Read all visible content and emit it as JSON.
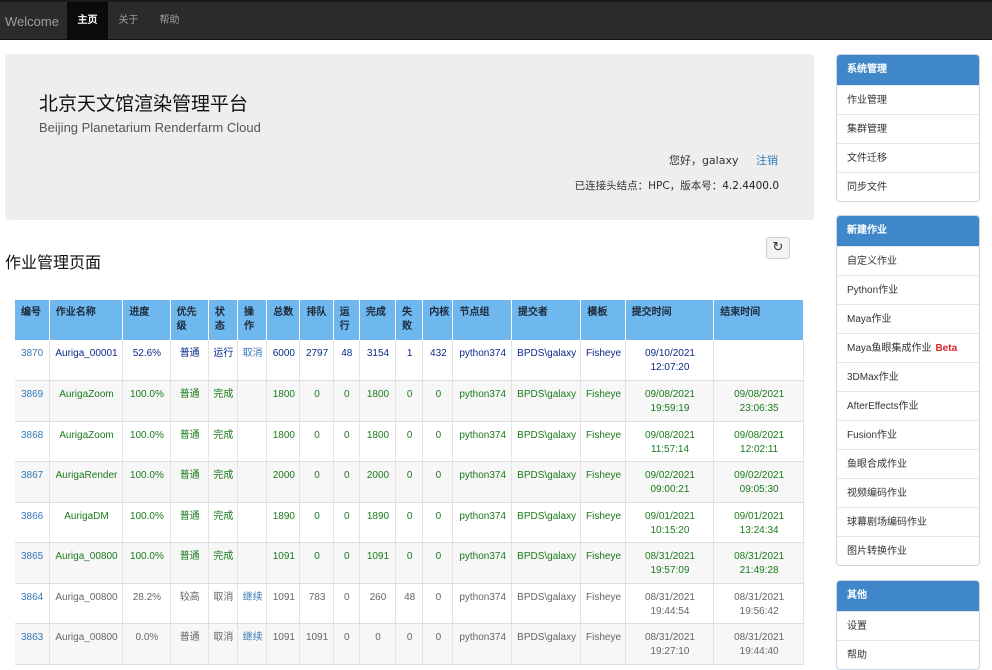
{
  "nav": {
    "brand": "Welcome",
    "tabs": [
      {
        "label": "主页",
        "active": true
      },
      {
        "label": "关于",
        "active": false
      },
      {
        "label": "帮助",
        "active": false
      }
    ]
  },
  "header": {
    "title_cn": "北京天文馆渲染管理平台",
    "title_en": "Beijing Planetarium Renderfarm Cloud",
    "greeting": "您好，galaxy",
    "logout": "注销",
    "connection_prefix": "已连接头结点：HPC，版本号：",
    "version": "4.2.4400.0"
  },
  "page": {
    "title": "作业管理页面",
    "refresh_icon": "↻"
  },
  "table": {
    "columns": [
      "编号",
      "作业名称",
      "进度",
      "优先级",
      "状态",
      "操作",
      "总数",
      "排队",
      "运行",
      "完成",
      "失败",
      "内核",
      "节点组",
      "提交者",
      "模板",
      "提交时间",
      "结束时间"
    ],
    "rows": [
      {
        "status_class": "running",
        "id": "3870",
        "name": "Auriga_00001",
        "progress": "52.6%",
        "priority": "普通",
        "state": "运行",
        "action": "取消",
        "total": "6000",
        "queued": "2797",
        "running": "48",
        "done": "3154",
        "failed": "1",
        "cores": "432",
        "group": "python374",
        "submitter": "BPDS\\galaxy",
        "template": "Fisheye",
        "submit_time": "09/10/2021 12:07:20",
        "end_time": ""
      },
      {
        "status_class": "done",
        "id": "3869",
        "name": "AurigaZoom",
        "progress": "100.0%",
        "priority": "普通",
        "state": "完成",
        "action": "",
        "total": "1800",
        "queued": "0",
        "running": "0",
        "done": "1800",
        "failed": "0",
        "cores": "0",
        "group": "python374",
        "submitter": "BPDS\\galaxy",
        "template": "Fisheye",
        "submit_time": "09/08/2021 19:59:19",
        "end_time": "09/08/2021 23:06:35"
      },
      {
        "status_class": "done",
        "id": "3868",
        "name": "AurigaZoom",
        "progress": "100.0%",
        "priority": "普通",
        "state": "完成",
        "action": "",
        "total": "1800",
        "queued": "0",
        "running": "0",
        "done": "1800",
        "failed": "0",
        "cores": "0",
        "group": "python374",
        "submitter": "BPDS\\galaxy",
        "template": "Fisheye",
        "submit_time": "09/08/2021 11:57:14",
        "end_time": "09/08/2021 12:02:11"
      },
      {
        "status_class": "done",
        "id": "3867",
        "name": "AurigaRender",
        "progress": "100.0%",
        "priority": "普通",
        "state": "完成",
        "action": "",
        "total": "2000",
        "queued": "0",
        "running": "0",
        "done": "2000",
        "failed": "0",
        "cores": "0",
        "group": "python374",
        "submitter": "BPDS\\galaxy",
        "template": "Fisheye",
        "submit_time": "09/02/2021 09:00:21",
        "end_time": "09/02/2021 09:05:30"
      },
      {
        "status_class": "done",
        "id": "3866",
        "name": "AurigaDM",
        "progress": "100.0%",
        "priority": "普通",
        "state": "完成",
        "action": "",
        "total": "1890",
        "queued": "0",
        "running": "0",
        "done": "1890",
        "failed": "0",
        "cores": "0",
        "group": "python374",
        "submitter": "BPDS\\galaxy",
        "template": "Fisheye",
        "submit_time": "09/01/2021 10:15:20",
        "end_time": "09/01/2021 13:24:34"
      },
      {
        "status_class": "done",
        "id": "3865",
        "name": "Auriga_00800",
        "progress": "100.0%",
        "priority": "普通",
        "state": "完成",
        "action": "",
        "total": "1091",
        "queued": "0",
        "running": "0",
        "done": "1091",
        "failed": "0",
        "cores": "0",
        "group": "python374",
        "submitter": "BPDS\\galaxy",
        "template": "Fisheye",
        "submit_time": "08/31/2021 19:57:09",
        "end_time": "08/31/2021 21:49:28"
      },
      {
        "status_class": "cancel",
        "id": "3864",
        "name": "Auriga_00800",
        "progress": "28.2%",
        "priority": "较高",
        "state": "取消",
        "action": "继续",
        "total": "1091",
        "queued": "783",
        "running": "0",
        "done": "260",
        "failed": "48",
        "cores": "0",
        "group": "python374",
        "submitter": "BPDS\\galaxy",
        "template": "Fisheye",
        "submit_time": "08/31/2021 19:44:54",
        "end_time": "08/31/2021 19:56:42"
      },
      {
        "status_class": "cancel",
        "id": "3863",
        "name": "Auriga_00800",
        "progress": "0.0%",
        "priority": "普通",
        "state": "取消",
        "action": "继续",
        "total": "1091",
        "queued": "1091",
        "running": "0",
        "done": "0",
        "failed": "0",
        "cores": "0",
        "group": "python374",
        "submitter": "BPDS\\galaxy",
        "template": "Fisheye",
        "submit_time": "08/31/2021 19:27:10",
        "end_time": "08/31/2021 19:44:40"
      }
    ]
  },
  "sidebar": {
    "system": {
      "title": "系统管理",
      "items": [
        "作业管理",
        "集群管理",
        "文件迁移",
        "同步文件"
      ]
    },
    "new_job": {
      "title": "新建作业",
      "items": [
        "自定义作业",
        "Python作业",
        "Maya作业",
        "Maya鱼眼集成作业",
        "3DMax作业",
        "AfterEffects作业",
        "Fusion作业",
        "鱼眼合成作业",
        "视频编码作业",
        "球幕剧场编码作业",
        "图片转换作业"
      ],
      "beta_label": "Beta"
    },
    "other": {
      "title": "其他",
      "items": [
        "设置",
        "帮助"
      ]
    }
  },
  "colors": {
    "navbar": "#2b2b2b",
    "table_header": "#6fb8ef",
    "panel_header": "#3f87c8",
    "link": "#337ab7",
    "done_text": "#1a7a1a",
    "running_text": "#0a2a8a",
    "beta": "#d9262b"
  }
}
